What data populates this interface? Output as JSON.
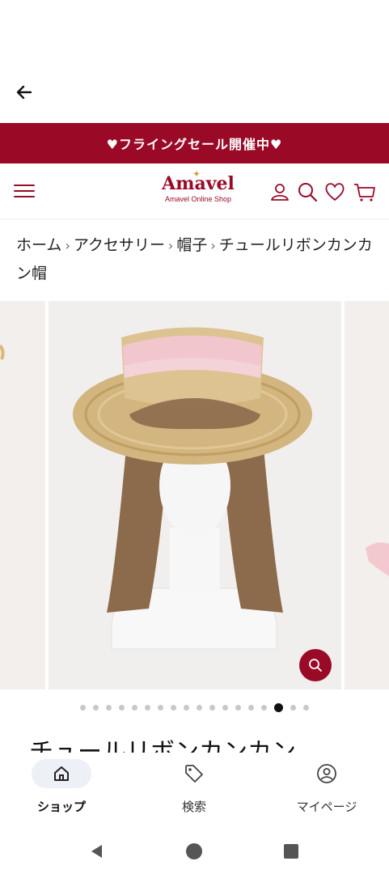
{
  "colors": {
    "brand": "#9a0a27",
    "accent_pink": "#f1c6cc",
    "nav_pill": "#eef0f7"
  },
  "appbar": {
    "back_icon": "arrow-left-icon"
  },
  "banner": {
    "text": "♥フライングセール開催中♥"
  },
  "header": {
    "logo_name": "Amavel",
    "logo_sub": "Amavel Online Shop",
    "icons": [
      "menu-icon",
      "account-icon",
      "search-icon",
      "heart-icon",
      "cart-icon"
    ]
  },
  "breadcrumb": {
    "items": [
      "ホーム",
      "アクセサリー",
      "帽子"
    ],
    "current": "チュールリボンカンカン帽",
    "separator": "›"
  },
  "gallery": {
    "total_images": 18,
    "active_index": 15,
    "zoom_icon": "zoom-search-icon"
  },
  "product": {
    "title": "チュールリボンカンカン"
  },
  "bottom_nav": [
    {
      "label": "ショップ",
      "icon": "home-icon",
      "active": true
    },
    {
      "label": "検索",
      "icon": "tag-icon",
      "active": false
    },
    {
      "label": "マイページ",
      "icon": "user-circle-icon",
      "active": false
    }
  ],
  "system_nav": [
    "back-triangle-icon",
    "home-circle-icon",
    "recents-square-icon"
  ]
}
